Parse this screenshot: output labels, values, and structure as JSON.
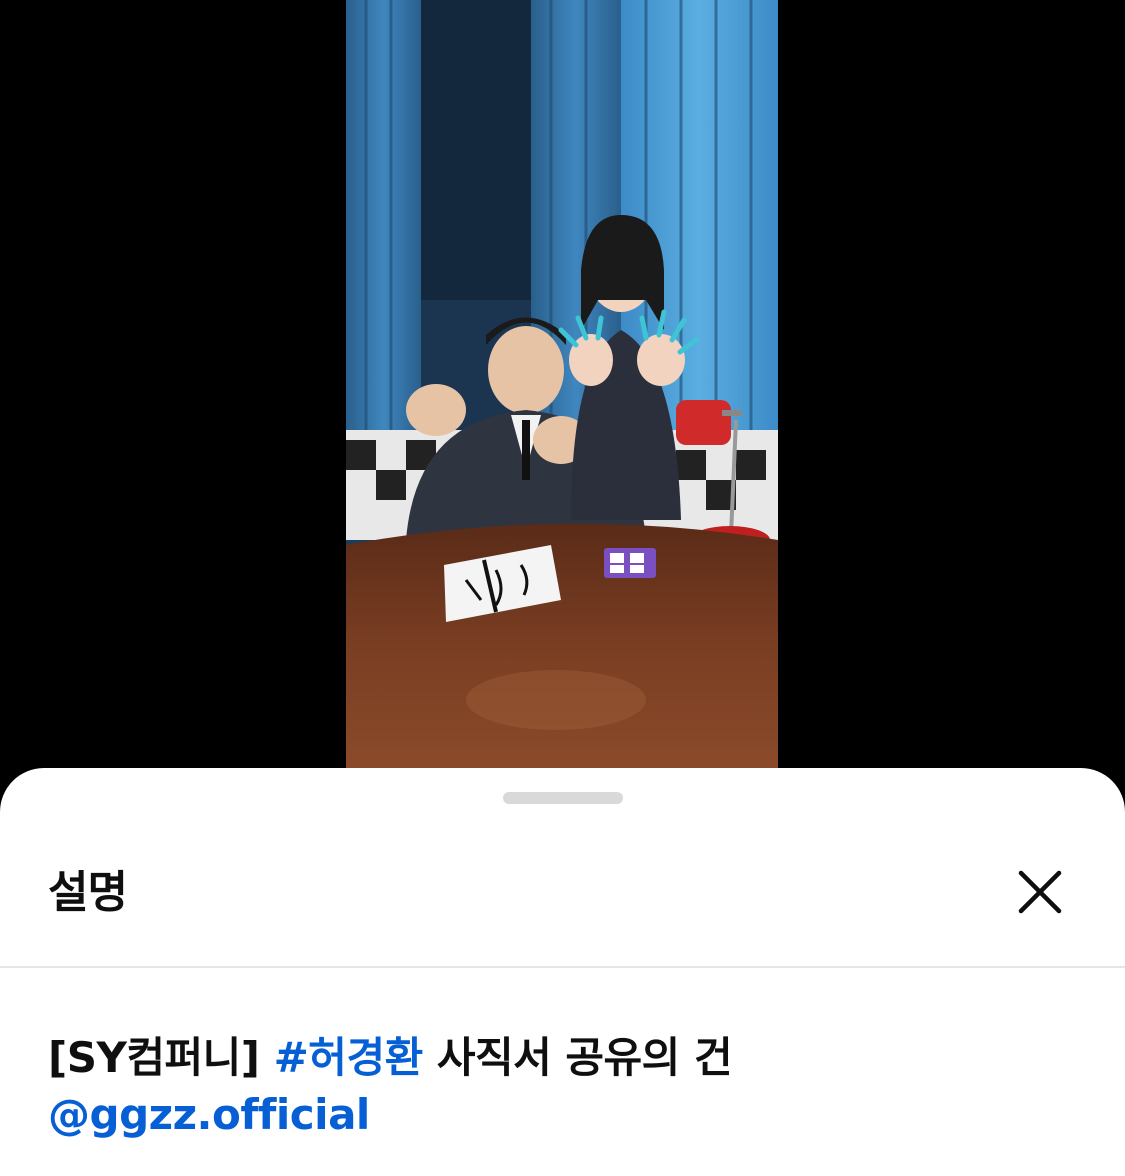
{
  "sheet": {
    "title": "설명",
    "close_icon": "close-icon"
  },
  "description": {
    "prefix": "[SY컴퍼니]",
    "hashtag": "#허경환",
    "suffix": "사직서 공유의 건",
    "mention": "@ggzz.official"
  },
  "colors": {
    "link": "#065fd4",
    "text": "#0f0f0f",
    "sheet_background": "#ffffff",
    "page_background": "#000000"
  }
}
